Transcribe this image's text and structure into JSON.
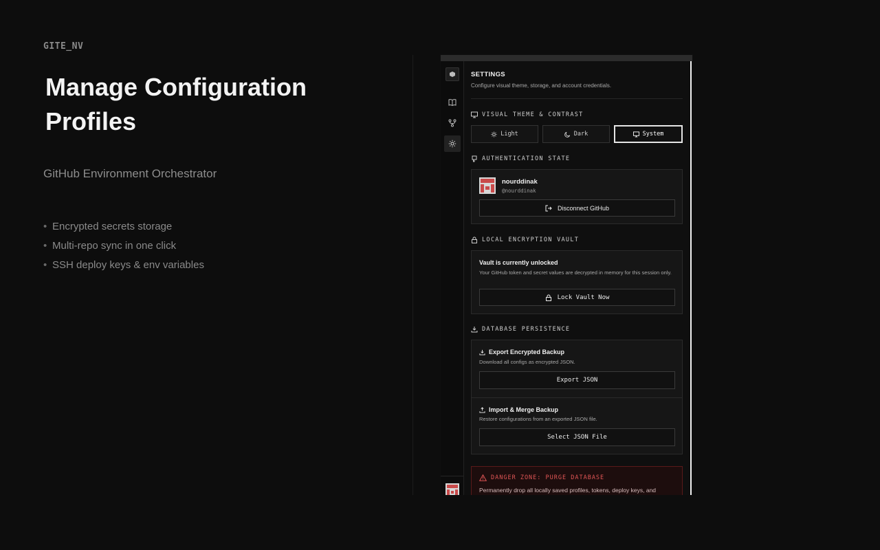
{
  "promo": {
    "brand": "GITE_NV",
    "headline": "Manage Configuration Profiles",
    "tagline": "GitHub Environment Orchestrator",
    "features": [
      "Encrypted secrets storage",
      "Multi-repo sync in one click",
      "SSH deploy keys & env variables"
    ]
  },
  "app": {
    "sidebar": {
      "items": [
        {
          "icon": "book-icon",
          "active": false
        },
        {
          "icon": "git-branch-icon",
          "active": false
        },
        {
          "icon": "gear-icon",
          "active": true
        }
      ]
    },
    "settings": {
      "title": "SETTINGS",
      "subtitle": "Configure visual theme, storage, and account credentials."
    },
    "theme": {
      "heading": "VISUAL THEME & CONTRAST",
      "options": [
        {
          "label": "Light",
          "icon": "sun-icon",
          "selected": false
        },
        {
          "label": "Dark",
          "icon": "moon-icon",
          "selected": false
        },
        {
          "label": "System",
          "icon": "monitor-icon",
          "selected": true
        }
      ]
    },
    "auth": {
      "heading": "AUTHENTICATION STATE",
      "username": "nourddinak",
      "handle": "@nourddinak",
      "disconnect_label": "Disconnect GitHub"
    },
    "vault": {
      "heading": "LOCAL ENCRYPTION VAULT",
      "status_title": "Vault is currently unlocked",
      "status_desc": "Your GitHub token and secret values are decrypted in memory for this session only.",
      "lock_label": "Lock Vault Now"
    },
    "database": {
      "heading": "DATABASE PERSISTENCE",
      "export_title": "Export Encrypted Backup",
      "export_desc": "Download all configs as encrypted JSON.",
      "export_button": "Export JSON",
      "import_title": "Import & Merge Backup",
      "import_desc": "Restore configurations from an exported JSON file.",
      "import_button": "Select JSON File"
    },
    "danger": {
      "heading": "DANGER ZONE: PURGE DATABASE",
      "desc": "Permanently drop all locally saved profiles, tokens, deploy keys, and"
    }
  },
  "colors": {
    "background": "#0d0d0d",
    "accent_danger": "#e05555",
    "selected_border": "#e6e6e6",
    "avatar_red": "#c94a4a"
  }
}
